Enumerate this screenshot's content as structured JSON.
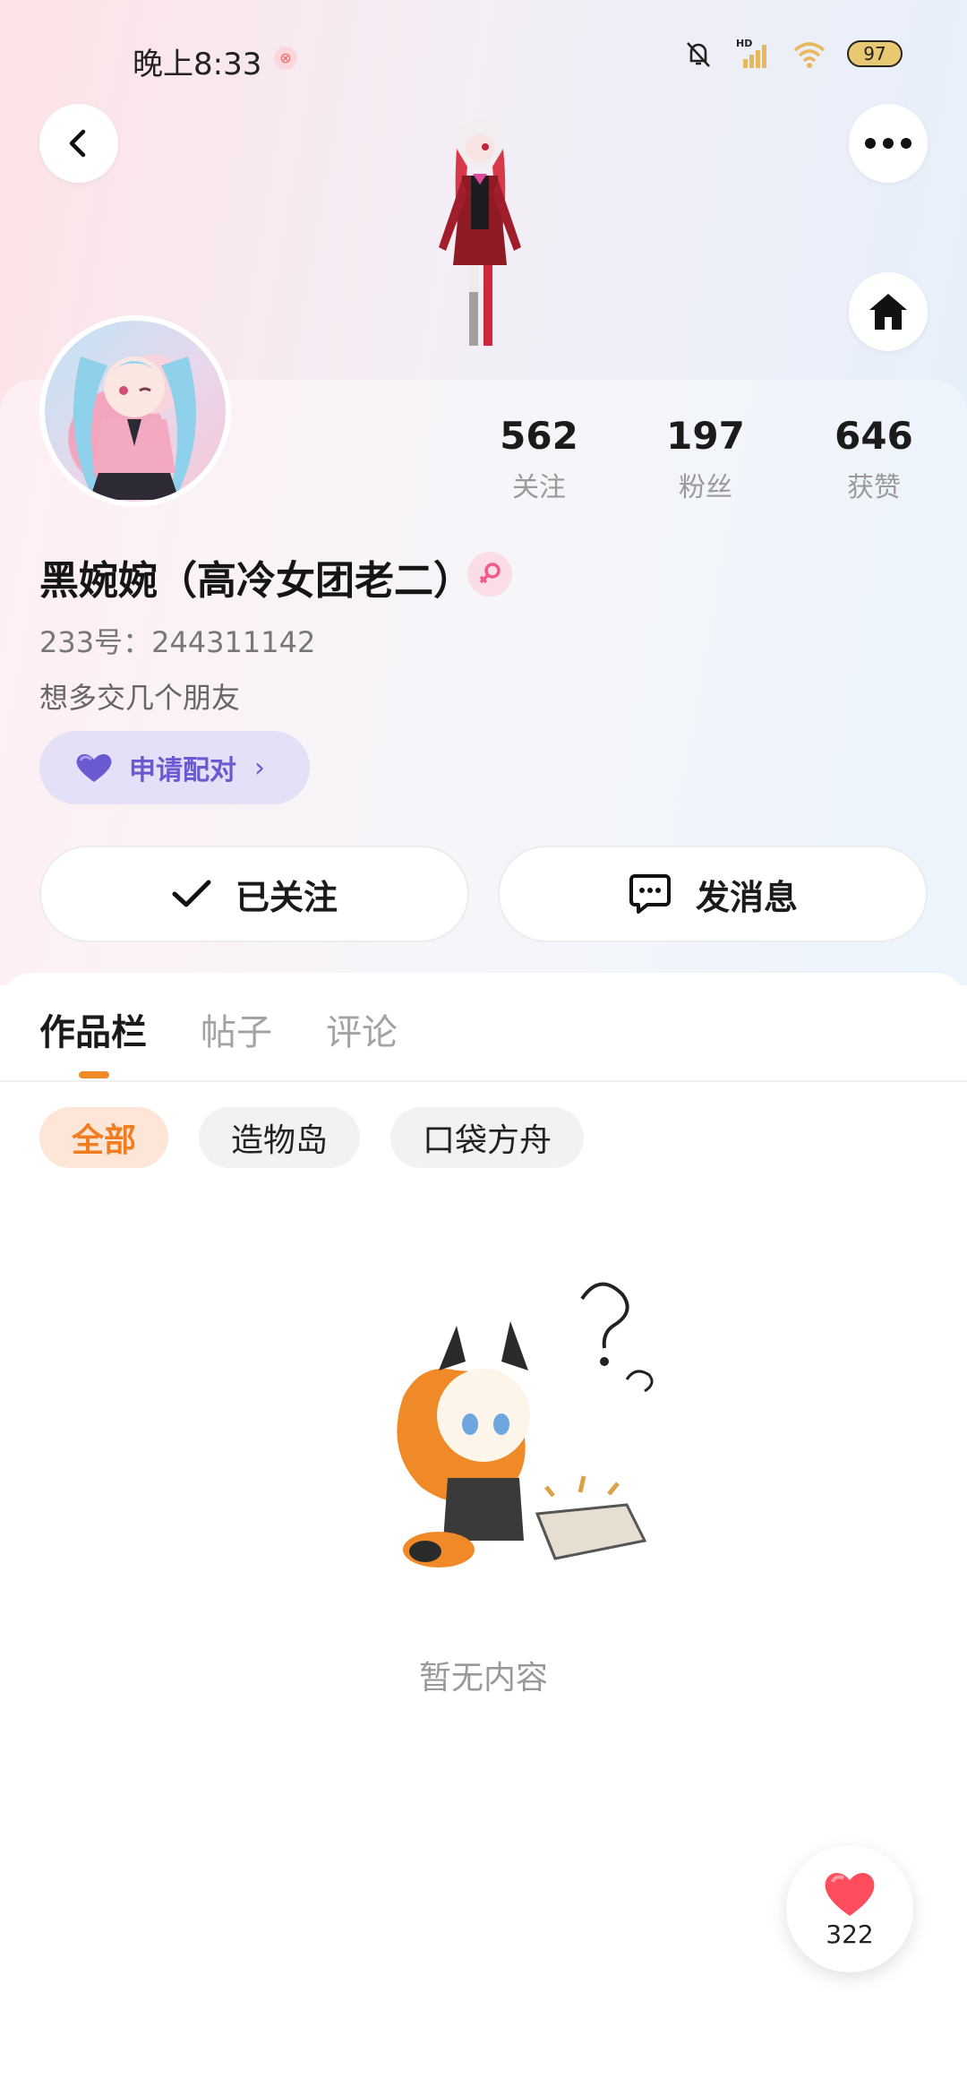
{
  "status_bar": {
    "time": "晚上8:33",
    "notification_badge_icon": "notification-badge-icon",
    "icons": [
      "mute-bell-icon",
      "hd-signal-icon",
      "wifi-icon",
      "battery-icon"
    ],
    "battery_level": "97"
  },
  "header": {
    "back_icon": "back-arrow-icon",
    "more_icon": "more-dots-icon",
    "home_icon": "home-icon"
  },
  "profile": {
    "stats": [
      {
        "value": "562",
        "label": "关注"
      },
      {
        "value": "197",
        "label": "粉丝"
      },
      {
        "value": "646",
        "label": "获赞"
      }
    ],
    "username": "黑婉婉（高冷女团老二）",
    "gender_icon": "female-icon",
    "uid": "233号：244311142",
    "bio": "想多交几个朋友",
    "pair_button": {
      "icon": "heart-icon",
      "label": "申请配对"
    }
  },
  "actions": {
    "followed_label": "已关注",
    "message_label": "发消息"
  },
  "tabs": [
    {
      "label": "作品栏",
      "active": true
    },
    {
      "label": "帖子",
      "active": false
    },
    {
      "label": "评论",
      "active": false
    }
  ],
  "filters": [
    {
      "label": "全部",
      "active": true
    },
    {
      "label": "造物岛",
      "active": false
    },
    {
      "label": "口袋方舟",
      "active": false
    }
  ],
  "empty_state": {
    "text": "暂无内容"
  },
  "like_fab": {
    "count": "322"
  },
  "colors": {
    "accent_orange": "#f07d20",
    "pair_purple": "#6a5ad2",
    "like_red": "#ff4d5e"
  }
}
